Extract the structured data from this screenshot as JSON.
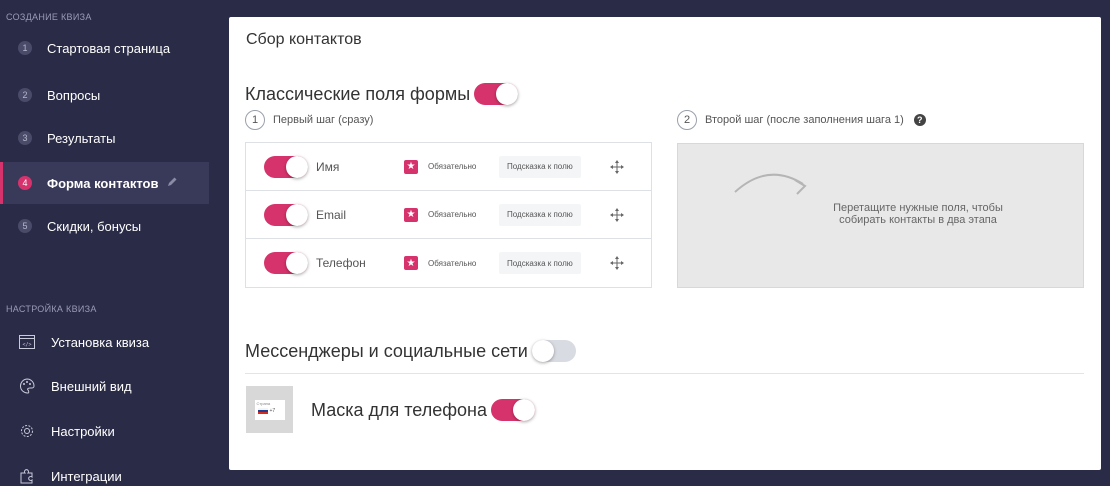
{
  "sidebar": {
    "section1": "СОЗДАНИЕ КВИЗА",
    "steps": [
      {
        "num": "1",
        "label": "Стартовая страница"
      },
      {
        "num": "2",
        "label": "Вопросы"
      },
      {
        "num": "3",
        "label": "Результаты"
      },
      {
        "num": "4",
        "label": "Форма контактов"
      },
      {
        "num": "5",
        "label": "Скидки, бонусы"
      }
    ],
    "section2": "НАСТРОЙКА КВИЗА",
    "settings": [
      {
        "icon": "code-window-icon",
        "label": "Установка квиза"
      },
      {
        "icon": "palette-icon",
        "label": "Внешний вид"
      },
      {
        "icon": "gear-icon",
        "label": "Настройки"
      },
      {
        "icon": "puzzle-icon",
        "label": "Интеграции"
      }
    ]
  },
  "main": {
    "title": "Сбор контактов",
    "classic_fields": {
      "heading": "Классические поля формы",
      "enabled": true
    },
    "step1": {
      "num": "1",
      "label": "Первый шаг (сразу)"
    },
    "step2": {
      "num": "2",
      "label": "Второй шаг (после заполнения шага 1)",
      "help": "?"
    },
    "fields": [
      {
        "name": "Имя",
        "enabled": true,
        "required_label": "Обязательно",
        "hint": "Подсказка к полю"
      },
      {
        "name": "Email",
        "enabled": true,
        "required_label": "Обязательно",
        "hint": "Подсказка к полю"
      },
      {
        "name": "Телефон",
        "enabled": true,
        "required_label": "Обязательно",
        "hint": "Подсказка к полю"
      }
    ],
    "required_mark": "★",
    "dropzone": {
      "line1": "Перетащите нужные поля, чтобы",
      "line2": "собирать контакты в два этапа"
    },
    "messengers": {
      "heading": "Мессенджеры и социальные сети",
      "enabled": false
    },
    "phone_mask": {
      "heading": "Маска для телефона",
      "enabled": true,
      "preview_country": "Страна",
      "preview_code": "+7"
    }
  },
  "colors": {
    "accent": "#d6336c",
    "sidebar_bg": "#2a2b47",
    "sidebar_active_bg": "#393a5a",
    "dropzone_bg": "#e8e8e8"
  }
}
